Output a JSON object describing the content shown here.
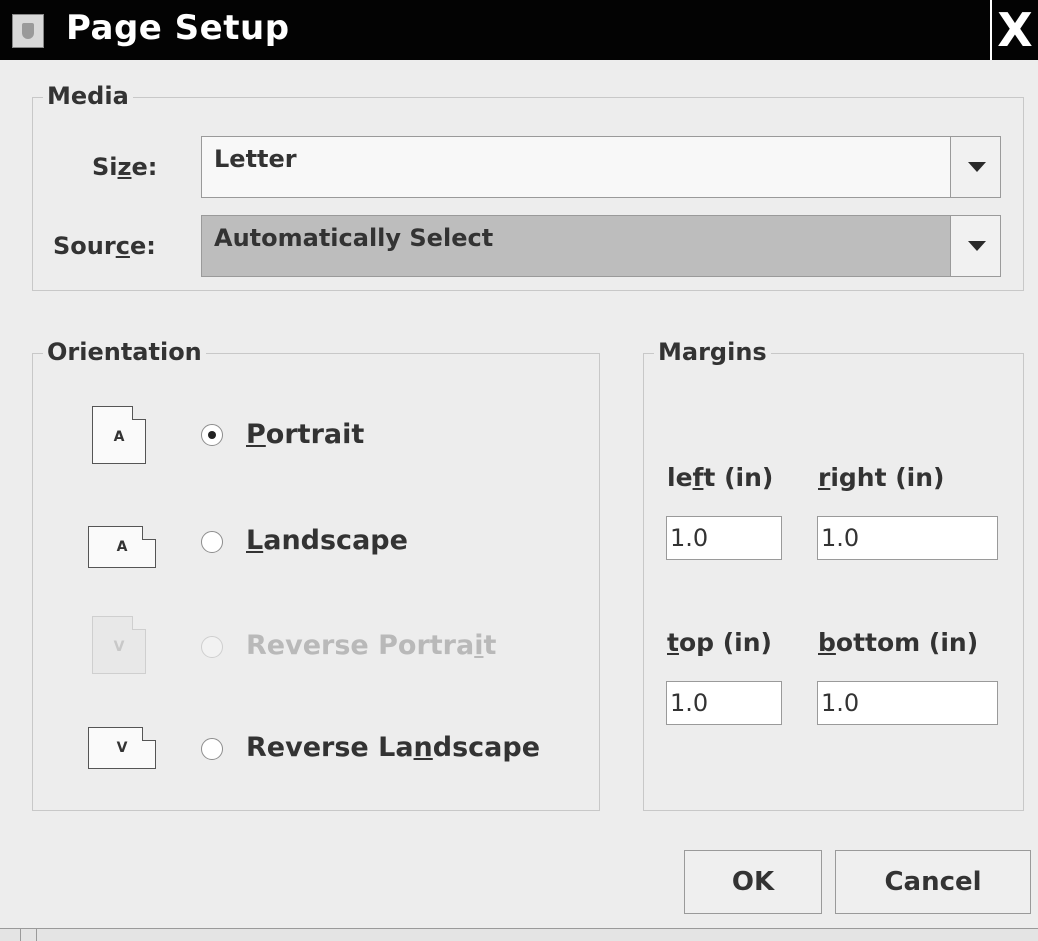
{
  "window": {
    "title": "Page Setup",
    "close_glyph": "X"
  },
  "media": {
    "title": "Media",
    "size": {
      "label_pre": "Si",
      "label_mnemonic": "z",
      "label_post": "e:",
      "value": "Letter"
    },
    "source": {
      "label_pre": "Sour",
      "label_mnemonic": "c",
      "label_post": "e:",
      "value": "Automatically Select"
    }
  },
  "orientation": {
    "title": "Orientation",
    "options": [
      {
        "icon_letter": "A",
        "pre": "",
        "mnemonic": "P",
        "post": "ortrait",
        "selected": true,
        "enabled": true
      },
      {
        "icon_letter": "A",
        "pre": "",
        "mnemonic": "L",
        "post": "andscape",
        "selected": false,
        "enabled": true
      },
      {
        "icon_letter": "V",
        "pre": "Reverse Portra",
        "mnemonic": "i",
        "post": "t",
        "selected": false,
        "enabled": false
      },
      {
        "icon_letter": "V",
        "pre": "Reverse La",
        "mnemonic": "n",
        "post": "dscape",
        "selected": false,
        "enabled": true
      }
    ]
  },
  "margins": {
    "title": "Margins",
    "left": {
      "pre": "le",
      "mnemonic": "f",
      "post": "t (in)",
      "value": "1.0"
    },
    "right": {
      "pre": "",
      "mnemonic": "r",
      "post": "ight (in)",
      "value": "1.0"
    },
    "top": {
      "pre": "",
      "mnemonic": "t",
      "post": "op (in)",
      "value": "1.0"
    },
    "bottom": {
      "pre": "",
      "mnemonic": "b",
      "post": "ottom (in)",
      "value": "1.0"
    }
  },
  "buttons": {
    "ok": "OK",
    "cancel": "Cancel"
  }
}
